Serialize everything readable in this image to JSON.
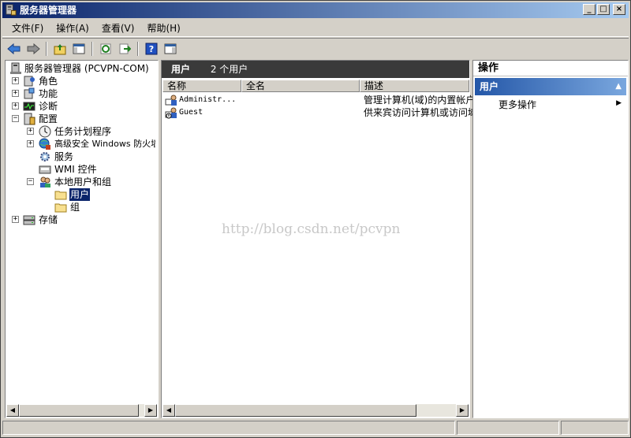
{
  "window": {
    "title": "服务器管理器"
  },
  "menu": [
    "文件(F)",
    "操作(A)",
    "查看(V)",
    "帮助(H)"
  ],
  "tree": {
    "root": "服务器管理器 (PCVPN-COM)",
    "roles": "角色",
    "features": "功能",
    "diagnostics": "诊断",
    "config": "配置",
    "task_scheduler": "任务计划程序",
    "firewall": "高级安全 Windows 防火墙",
    "services": "服务",
    "wmi": "WMI 控件",
    "local_users_groups": "本地用户和组",
    "users": "用户",
    "groups": "组",
    "storage": "存储"
  },
  "middle": {
    "header_title": "用户",
    "header_count": "2 个用户",
    "columns": [
      "名称",
      "全名",
      "描述"
    ],
    "rows": [
      {
        "name": "Administr...",
        "fullname": "",
        "desc": "管理计算机(域)的内置帐户"
      },
      {
        "name": "Guest",
        "fullname": "",
        "desc": "供来宾访问计算机或访问域"
      }
    ],
    "watermark": "http://blog.csdn.net/pcvpn"
  },
  "actions": {
    "title": "操作",
    "section": "用户",
    "more": "更多操作"
  }
}
